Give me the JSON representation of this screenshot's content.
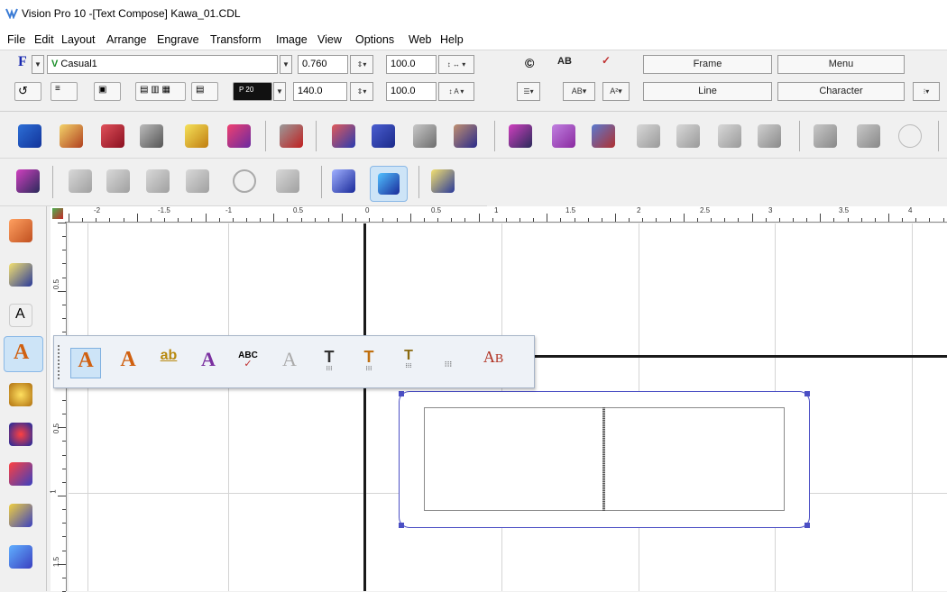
{
  "window": {
    "title": "Vision Pro 10 -[Text Compose] Kawa_01.CDL",
    "app_icon": "vision-pro-icon"
  },
  "menu": [
    "File",
    "Edit",
    "Layout",
    "Arrange",
    "Engrave",
    "Transform",
    "Image",
    "View",
    "Options",
    "Web",
    "Help"
  ],
  "format": {
    "font_name": "Casual1",
    "font_type_letter": "F",
    "font_type_v": "V",
    "height": "0.760",
    "width_pct": "100.0",
    "line_spacing": "140.0",
    "char_spacing": "100.0",
    "row_pos": "20",
    "buttons": {
      "frame": "Frame",
      "menu": "Menu",
      "line": "Line",
      "character": "Character"
    }
  },
  "ruler": {
    "h_labels": [
      "-2",
      "-1.5",
      "-1",
      "0.5",
      "0",
      "0.5",
      "1",
      "1.5",
      "2",
      "2.5",
      "3",
      "3.5",
      "4"
    ],
    "v_labels": [
      "0.5",
      "0.5",
      "1",
      "1.5"
    ]
  },
  "flyout": {
    "items": [
      "text-frame-icon",
      "text-icon",
      "arc-text-icon",
      "text-on-path-icon",
      "spell-check-icon",
      "outline-text-icon",
      "text-tracking-icon",
      "text-kerning-icon",
      "text-baseline-icon",
      "text-numbers-icon",
      "text-case-icon"
    ],
    "abc_label": "ABC",
    "ab_label": "AB"
  },
  "colors": {
    "accent": "#3a3ec0",
    "frame": "#4b4fc4",
    "canvas": "#ffffff"
  }
}
